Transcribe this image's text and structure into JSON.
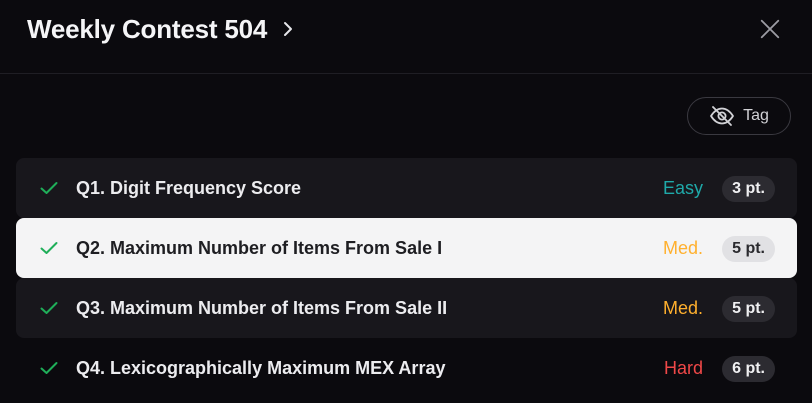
{
  "header": {
    "title": "Weekly Contest 504"
  },
  "tag_button": {
    "label": "Tag"
  },
  "colors": {
    "easy": "#1fa9a9",
    "medium": "#ffb02e",
    "hard": "#f04848",
    "check": "#1fae59"
  },
  "questions": [
    {
      "title": "Q1. Digit Frequency Score",
      "difficulty": "Easy",
      "level": "easy",
      "points": "3 pt.",
      "solved": true,
      "selected": false
    },
    {
      "title": "Q2. Maximum Number of Items From Sale I",
      "difficulty": "Med.",
      "level": "medium",
      "points": "5 pt.",
      "solved": true,
      "selected": true
    },
    {
      "title": "Q3. Maximum Number of Items From Sale II",
      "difficulty": "Med.",
      "level": "medium",
      "points": "5 pt.",
      "solved": true,
      "selected": false
    },
    {
      "title": "Q4. Lexicographically Maximum MEX Array",
      "difficulty": "Hard",
      "level": "hard",
      "points": "6 pt.",
      "solved": true,
      "selected": false
    }
  ]
}
